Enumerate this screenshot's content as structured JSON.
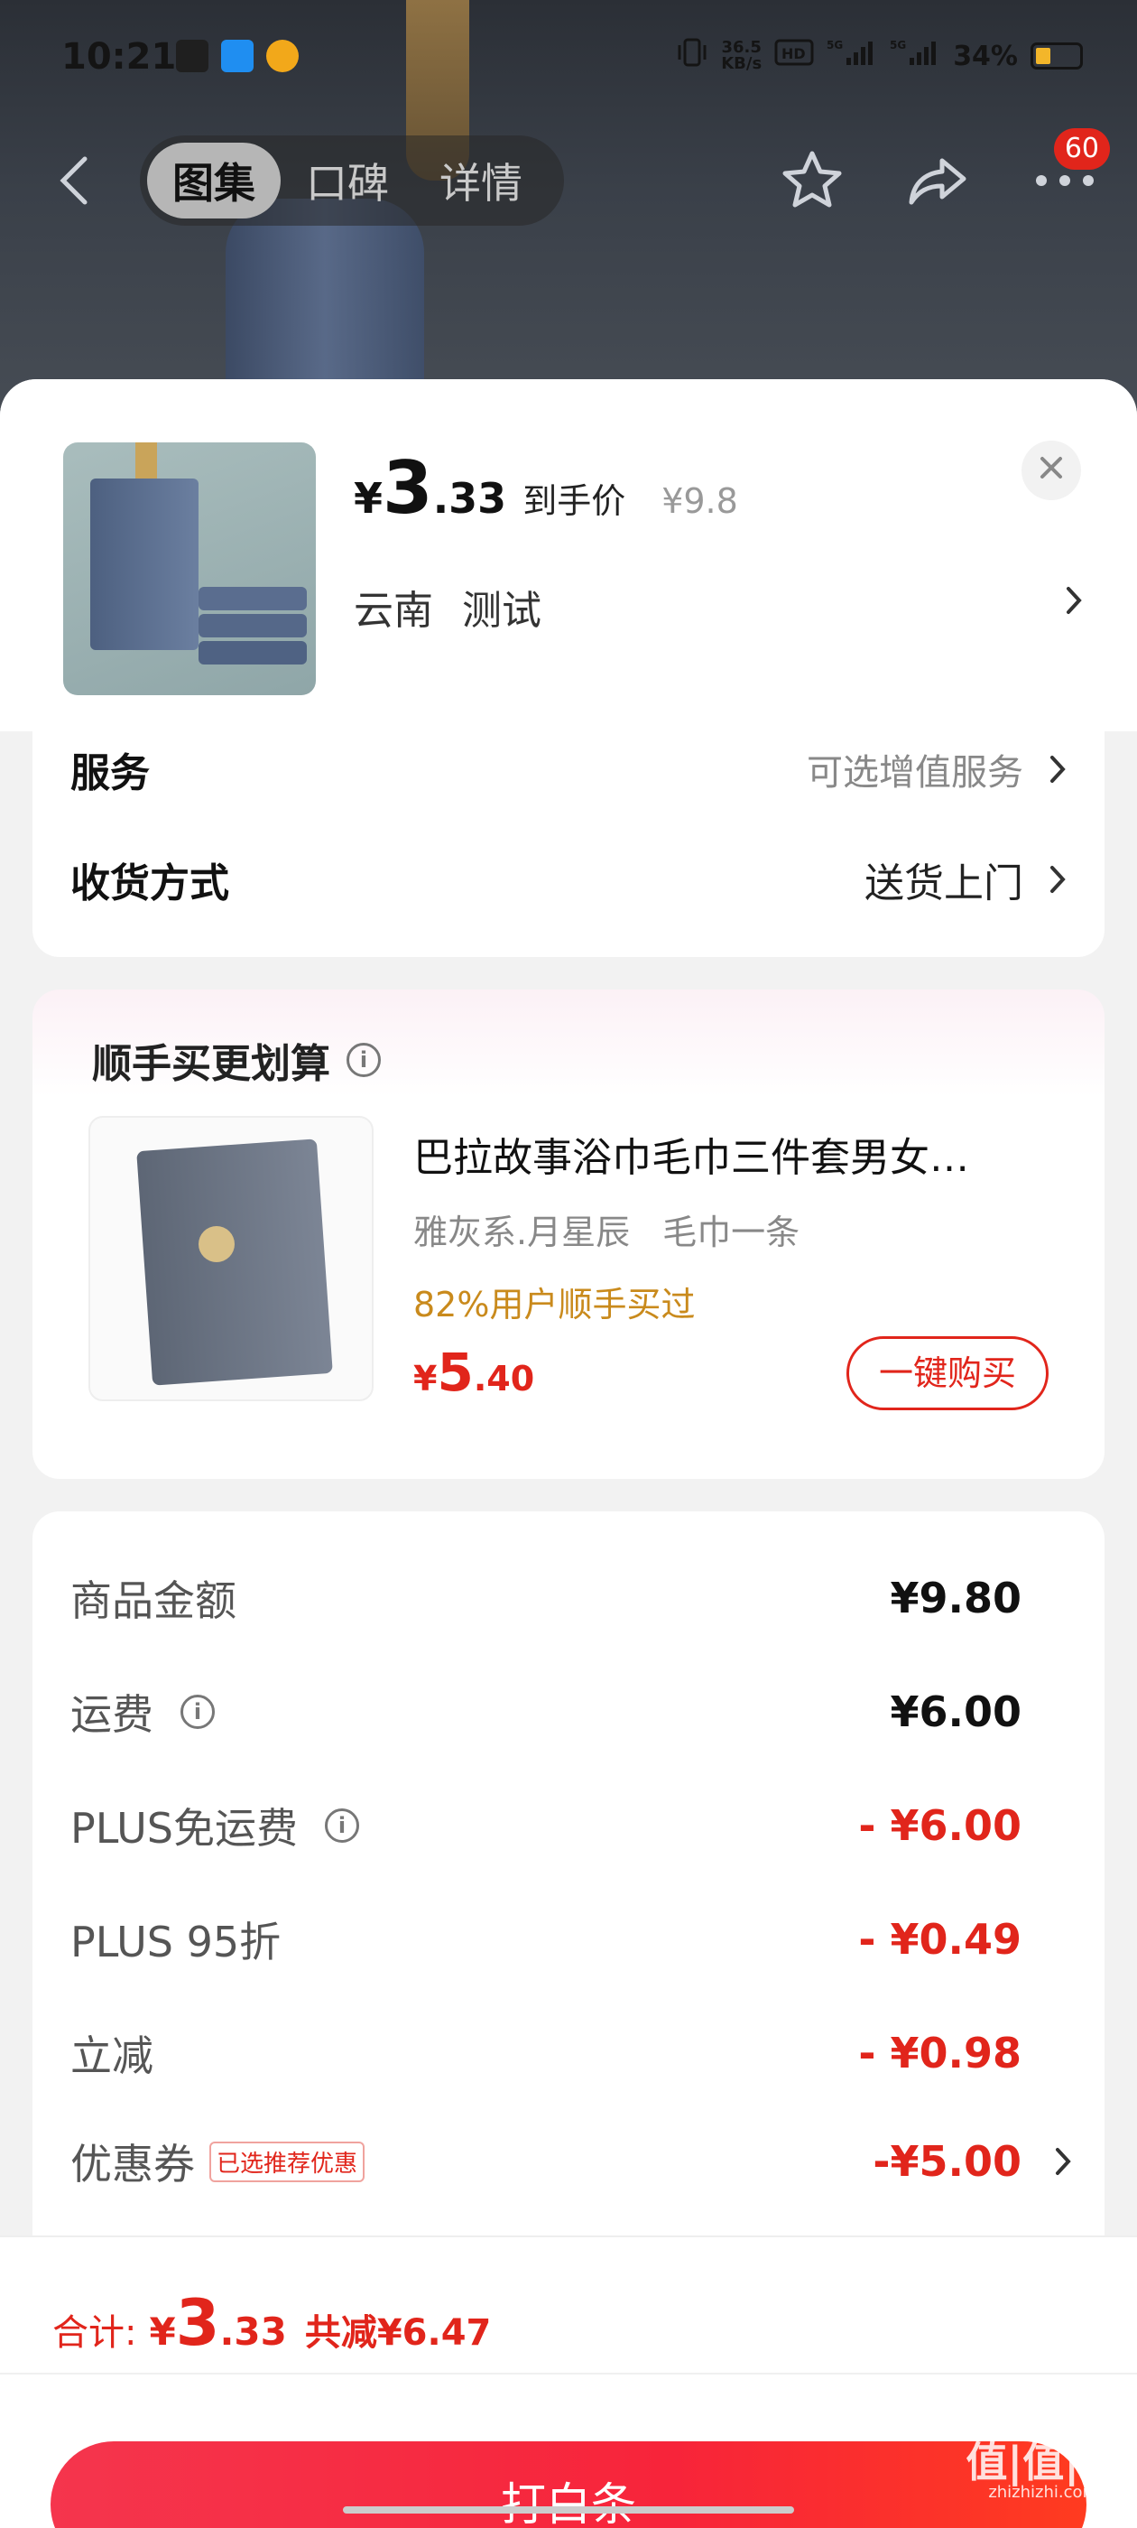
{
  "status_bar": {
    "time": "10:21",
    "net_speed_top": "36.5",
    "net_speed_bottom": "KB/s",
    "battery": "34%"
  },
  "nav": {
    "tabs": [
      {
        "label": "图集"
      },
      {
        "label": "口碑"
      },
      {
        "label": "详情"
      }
    ],
    "message_badge": "60"
  },
  "product": {
    "price_currency": "¥",
    "price_int": "3",
    "price_dec": ".33",
    "price_tag": "到手价",
    "original_price": "¥9.8",
    "region": "云南",
    "spec": "测试"
  },
  "service": {
    "service_label": "服务",
    "service_value": "可选增值服务",
    "delivery_label": "收货方式",
    "delivery_value": "送货上门"
  },
  "bundle": {
    "title": "顺手买更划算",
    "name": "巴拉故事浴巾毛巾三件套男女…",
    "spec_color": "雅灰系.月星辰",
    "spec_item": "毛巾一条",
    "rate_text": "82%用户顺手买过",
    "price_currency": "¥",
    "price_int": "5",
    "price_dec": ".40",
    "buy_label": "一键购买"
  },
  "summary": {
    "rows": [
      {
        "label": "商品金额",
        "value": "¥9.80"
      },
      {
        "label": "运费",
        "value": "¥6.00"
      },
      {
        "label": "PLUS免运费",
        "value": "- ¥6.00"
      },
      {
        "label": "PLUS 95折",
        "value": "- ¥0.49"
      },
      {
        "label": "立减",
        "value": "- ¥0.98"
      },
      {
        "label": "优惠券",
        "value": "-¥5.00",
        "tag": "已选推荐优惠"
      }
    ]
  },
  "footer": {
    "total_label": "合计:",
    "total_currency": "¥",
    "total_int": "3",
    "total_dec": ".33",
    "total_save": "共减¥6.47",
    "pay_label": "打白条"
  },
  "watermark": {
    "main": "值|值|值",
    "sub": "zhizhizhi.com"
  },
  "colors": {
    "accent_red": "#e1251b",
    "rate_orange": "#c98a1c",
    "pay_gradient_start": "#f5354d",
    "pay_gradient_end": "#ff3b1f"
  },
  "icons": [
    "back-icon",
    "star-icon",
    "share-icon",
    "more-icon",
    "close-icon",
    "chevron-right-icon",
    "info-icon"
  ]
}
